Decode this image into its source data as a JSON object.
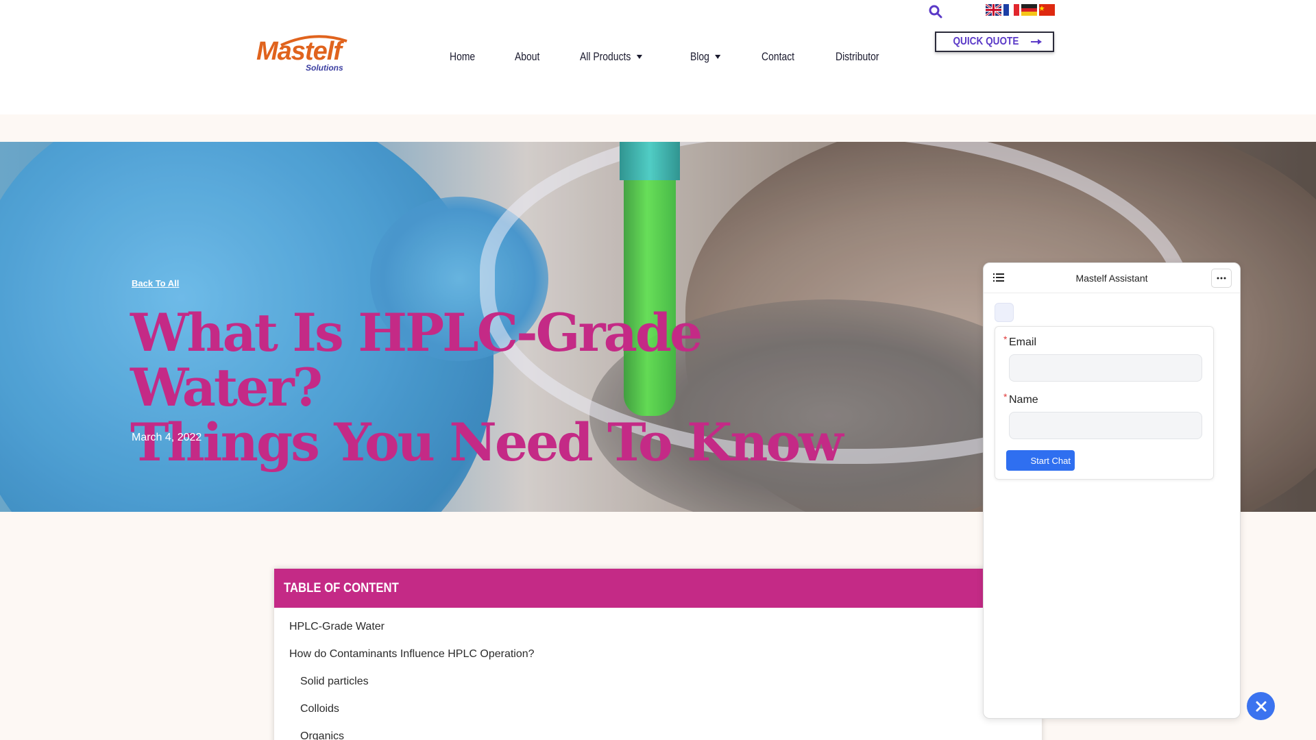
{
  "header": {
    "logo": {
      "name": "Mastelf",
      "tagline": "Solutions"
    },
    "nav": [
      {
        "label": "Home",
        "has_dropdown": false
      },
      {
        "label": "About",
        "has_dropdown": false
      },
      {
        "label": "All Products",
        "has_dropdown": true
      },
      {
        "label": "Blog",
        "has_dropdown": true
      },
      {
        "label": "Contact",
        "has_dropdown": false
      },
      {
        "label": "Distributor",
        "has_dropdown": false
      }
    ],
    "search_icon": "search-icon",
    "languages": [
      "English",
      "French",
      "German",
      "Chinese"
    ],
    "quick_quote_label": "QUICK QUOTE"
  },
  "hero": {
    "back_link": "Back To All",
    "title_line1": "What Is HPLC-Grade Water?",
    "title_line2": "Things You Need To Know",
    "date": "March 4, 2022"
  },
  "toc": {
    "heading": "TABLE OF CONTENT",
    "items": [
      {
        "label": "HPLC-Grade Water",
        "level": 1
      },
      {
        "label": "How do Contaminants Influence HPLC Operation?",
        "level": 1
      },
      {
        "label": "Solid particles",
        "level": 2
      },
      {
        "label": "Colloids",
        "level": 2
      },
      {
        "label": "Organics",
        "level": 2
      }
    ]
  },
  "chat": {
    "title": "Mastelf Assistant",
    "email_label": "Email",
    "name_label": "Name",
    "required_mark": "*",
    "start_label": "Start Chat"
  },
  "colors": {
    "accent_magenta": "#c42a86",
    "brand_purple": "#5a39c7",
    "chat_blue": "#2f6ff0",
    "logo_orange": "#e0631d"
  }
}
